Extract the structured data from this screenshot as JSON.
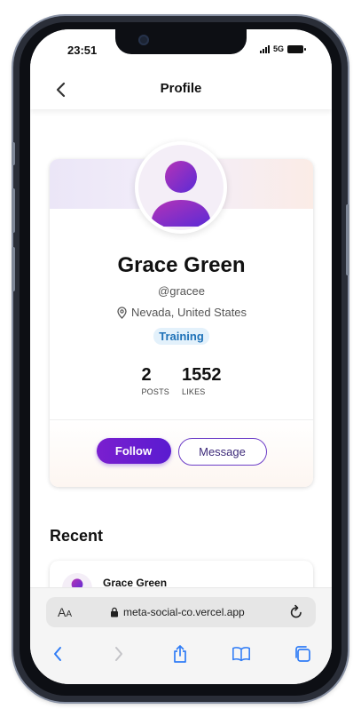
{
  "status_bar": {
    "time": "23:51",
    "network": "5G"
  },
  "header": {
    "title": "Profile"
  },
  "profile": {
    "name": "Grace Green",
    "handle": "@gracee",
    "location": "Nevada, United States",
    "badge": "Training",
    "stats": [
      {
        "value": "2",
        "label": "POSTS"
      },
      {
        "value": "1552",
        "label": "LIKES"
      }
    ],
    "follow_label": "Follow",
    "message_label": "Message"
  },
  "recent": {
    "title": "Recent",
    "items": [
      {
        "author": "Grace Green"
      }
    ]
  },
  "browser": {
    "text_size_label_big": "A",
    "text_size_label_small": "A",
    "url": "meta-social-co.vercel.app"
  },
  "colors": {
    "accent": "#5a1bd0",
    "badge_text": "#1f72b8",
    "badge_bg": "#e3f1fb",
    "ios_blue": "#2f7cf6"
  },
  "icons": {
    "back": "chevron-left-icon",
    "location": "map-pin-icon",
    "lock": "lock-icon",
    "reload": "reload-icon",
    "share": "share-icon",
    "bookmarks": "book-icon",
    "tabs": "tabs-icon"
  }
}
